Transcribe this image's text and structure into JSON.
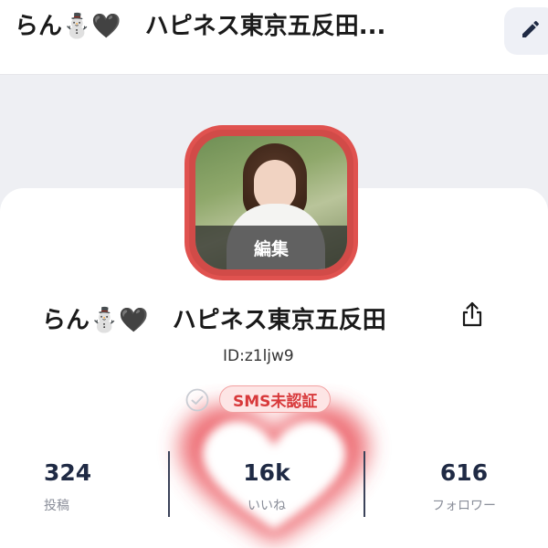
{
  "header": {
    "title": "らん⛄🖤　ハピネス東京五反田...",
    "edit_icon": "pencil-icon"
  },
  "profile": {
    "avatar_overlay_label": "編集",
    "name": "らん⛄🖤　ハピネス東京五反田",
    "share_icon": "share-icon",
    "user_id": "ID:z1ljw9",
    "verification_badge": "SMS未認証",
    "verification_icon": "check-circle-icon"
  },
  "stats": [
    {
      "value": "324",
      "label": "投稿"
    },
    {
      "value": "16k",
      "label": "いいね"
    },
    {
      "value": "616",
      "label": "フォロワー"
    }
  ],
  "colors": {
    "accent_red": "#e0524f",
    "badge_text": "#d8393b",
    "badge_bg": "#fde5e5",
    "stat_value": "#1f2a44",
    "stat_label": "#8a8e99",
    "heart_glow": "#e8404a"
  }
}
